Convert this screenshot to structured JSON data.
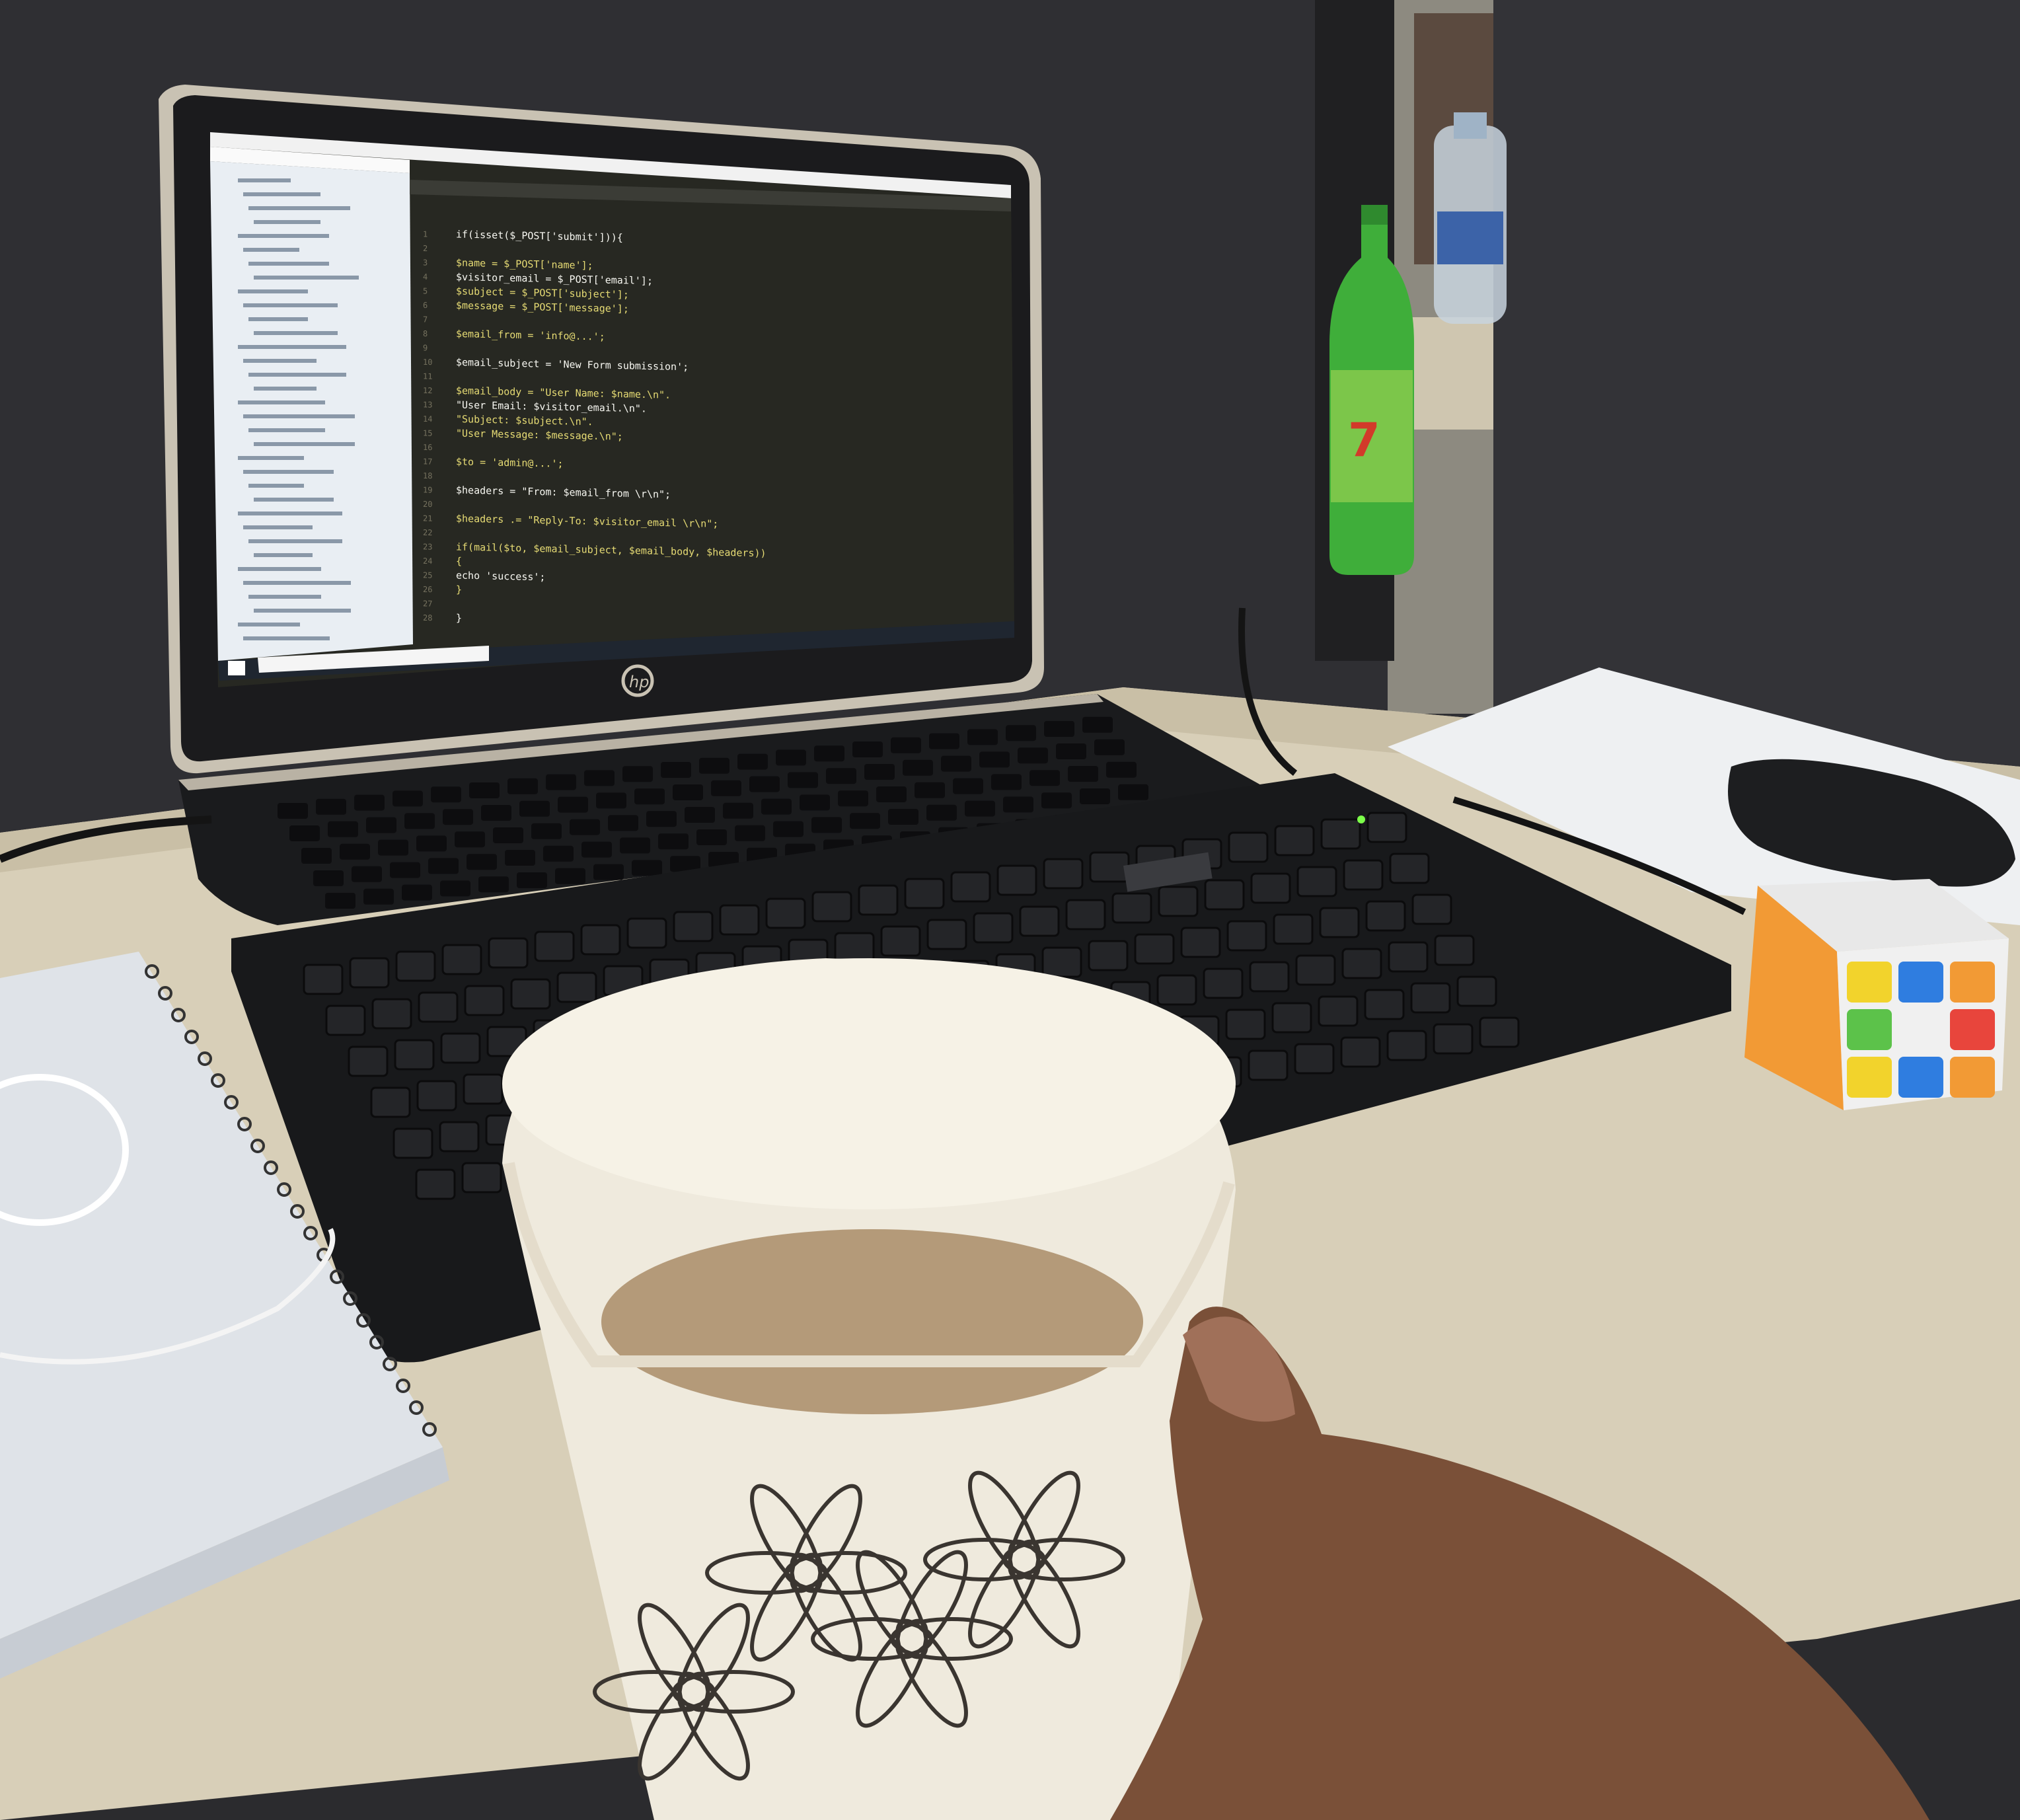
{
  "scene": {
    "description_tag": "photo",
    "colors": {
      "wall": "#2f2f33",
      "desk": "#d8cfb8",
      "laptop_bezel": "#1b1b1d",
      "laptop_trim": "#c9c2b3",
      "editor_bg": "#272822",
      "sidebar_bg": "#e9eef3",
      "keyboard": "#18191b",
      "mug": "#efeadd",
      "coffee": "#b49a79",
      "skin": "#7a5038",
      "bottle_green": "#3fae3a"
    }
  },
  "laptop": {
    "brand_logo": "hp-logo",
    "screen": {
      "app": "code-editor",
      "taskbar_search_placeholder": "",
      "code_lines": [
        "if(isset($_POST['submit'])){",
        "",
        "$name = $_POST['name'];",
        "$visitor_email = $_POST['email'];",
        "$subject = $_POST['subject'];",
        "$message = $_POST['message'];",
        "",
        "$email_from = 'info@...';",
        "",
        "$email_subject = 'New Form submission';",
        "",
        "$email_body = \"User Name: $name.\\n\".",
        "              \"User Email: $visitor_email.\\n\".",
        "              \"Subject: $subject.\\n\".",
        "              \"User Message: $message.\\n\";",
        "",
        "$to = 'admin@...';",
        "",
        "$headers = \"From: $email_from \\r\\n\";",
        "",
        "$headers .= \"Reply-To: $visitor_email \\r\\n\";",
        "",
        "if(mail($to, $email_subject, $email_body, $headers))",
        "{",
        "  echo 'success';",
        "}",
        "",
        "}"
      ]
    }
  },
  "keyboard": {
    "brand": ""
  },
  "mug": {
    "pattern": "floral-outline"
  }
}
